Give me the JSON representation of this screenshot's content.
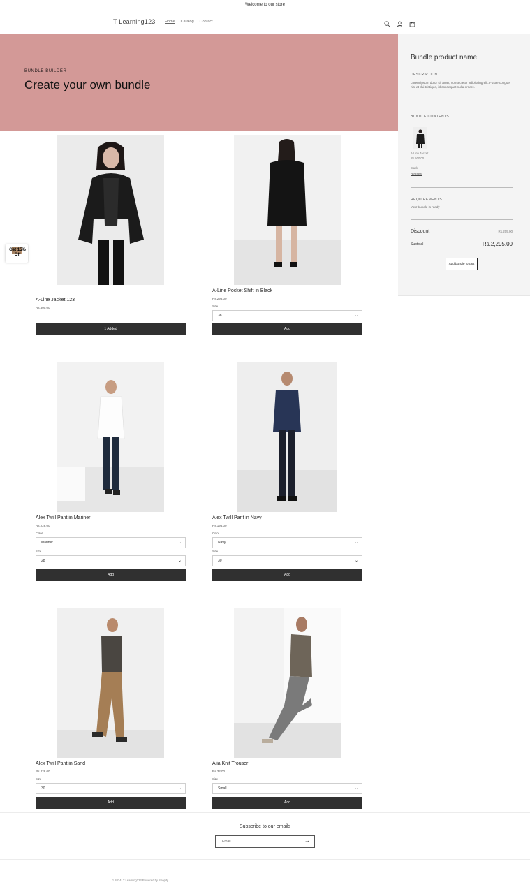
{
  "announcement": "Welcome to our store",
  "header": {
    "logo": "T Learning123",
    "nav": [
      "Home",
      "Catalog",
      "Contact"
    ],
    "icons": [
      "search-icon",
      "account-icon",
      "cart-icon"
    ]
  },
  "hero": {
    "eyebrow": "BUNDLE BUILDER",
    "title": "Create your own bundle",
    "background": "#d39997"
  },
  "bundle": {
    "title": "Bundle product name",
    "description_label": "DESCRIPTION",
    "description": "Lorem ipsum dolor sit amet, consectetur adipiscing elit. Fusce congue nisl at dui tristique, id consequat nulla ornare.",
    "contents_label": "BUNDLE CONTENTS",
    "item": {
      "name": "A-Line Jacket",
      "price": "Rs.500.00",
      "variant": "Black",
      "remove": "Remove"
    },
    "requirements_label": "REQUIREMENTS",
    "requirements_text": "Your bundle is ready",
    "discount_label": "Discount",
    "discount_value": "Rs.205.00",
    "subtotal_label": "Subtotal",
    "subtotal_value": "Rs.2,295.00",
    "cta": "Add bundle to cart"
  },
  "products": [
    {
      "name": "A-Line Jacket 123",
      "price": "Rs.500.00",
      "fields": [],
      "button": "1 Added"
    },
    {
      "name": "A-Line Pocket Shift in Black",
      "price": "Rs.298.00",
      "fields": [
        {
          "label": "Size",
          "value": "38"
        }
      ],
      "button": "Add"
    },
    {
      "name": "Alex Twill Pant in Mariner",
      "price": "Rs.228.00",
      "fields": [
        {
          "label": "Color",
          "value": "Mariner"
        },
        {
          "label": "Size",
          "value": "28"
        }
      ],
      "button": "Add"
    },
    {
      "name": "Alex Twill Pant in Navy",
      "price": "Rs.196.00",
      "fields": [
        {
          "label": "Color",
          "value": "Navy"
        },
        {
          "label": "Size",
          "value": "30"
        }
      ],
      "button": "Add"
    },
    {
      "name": "Alex Twill Pant in Sand",
      "price": "Rs.228.00",
      "fields": [
        {
          "label": "Size",
          "value": "30"
        }
      ],
      "button": "Add"
    },
    {
      "name": "Alia Knit Trouser",
      "price": "Rs.32.00",
      "fields": [
        {
          "label": "Size",
          "value": "Small"
        }
      ],
      "button": "Add"
    }
  ],
  "promo": {
    "text": "Get 15% Off"
  },
  "newsletter": {
    "title": "Subscribe to our emails",
    "placeholder": "Email"
  },
  "footer": "© 2024, T Learning123 Powered by Shopify"
}
